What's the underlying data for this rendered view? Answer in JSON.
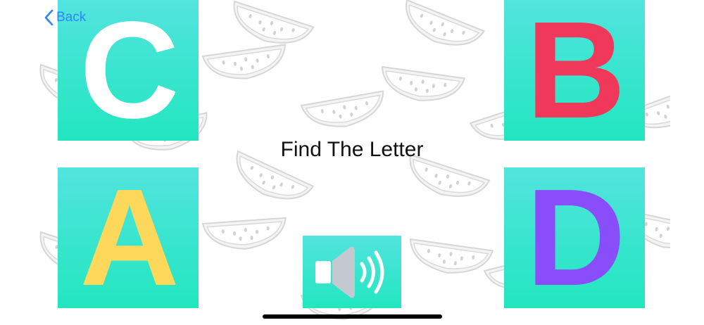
{
  "nav": {
    "back_label": "Back"
  },
  "prompt": {
    "text": "Find The Letter"
  },
  "tiles": [
    {
      "letter": "C",
      "color": "#ffffff"
    },
    {
      "letter": "B",
      "color": "#f0385a"
    },
    {
      "letter": "A",
      "color": "#fdd85a"
    },
    {
      "letter": "D",
      "color": "#8a4dfa"
    }
  ],
  "sound": {
    "icon": "speaker-icon"
  },
  "colors": {
    "tile_top": "#52e4de",
    "tile_bottom": "#22e6c0",
    "accent": "#2f86f6"
  }
}
